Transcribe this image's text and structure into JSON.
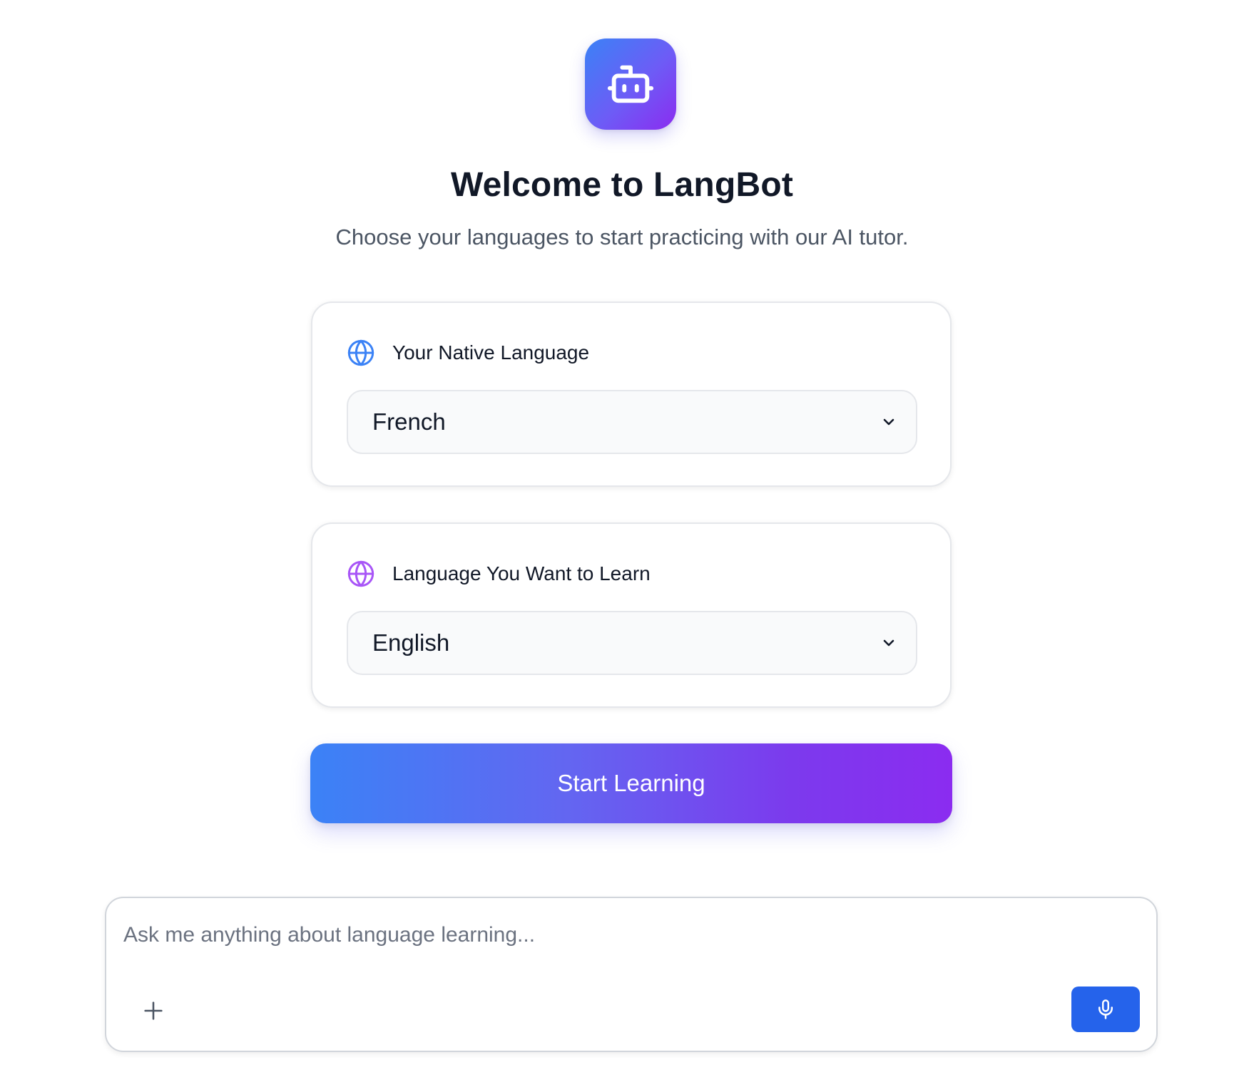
{
  "brand": {
    "logo_icon": "bot-icon",
    "gradient_start": "#3b82f6",
    "gradient_end": "#8b2cf0"
  },
  "header": {
    "title": "Welcome to LangBot",
    "subtitle": "Choose your languages to start practicing with our AI tutor."
  },
  "native_language": {
    "icon": "globe-icon",
    "icon_color": "#3b82f6",
    "label": "Your Native Language",
    "selected": "French"
  },
  "target_language": {
    "icon": "globe-icon",
    "icon_color": "#a855f7",
    "label": "Language You Want to Learn",
    "selected": "English"
  },
  "start_button": {
    "label": "Start Learning"
  },
  "chat": {
    "placeholder": "Ask me anything about language learning...",
    "value": "",
    "add_icon": "plus-icon",
    "mic_icon": "microphone-icon",
    "mic_button_color": "#2563eb"
  }
}
